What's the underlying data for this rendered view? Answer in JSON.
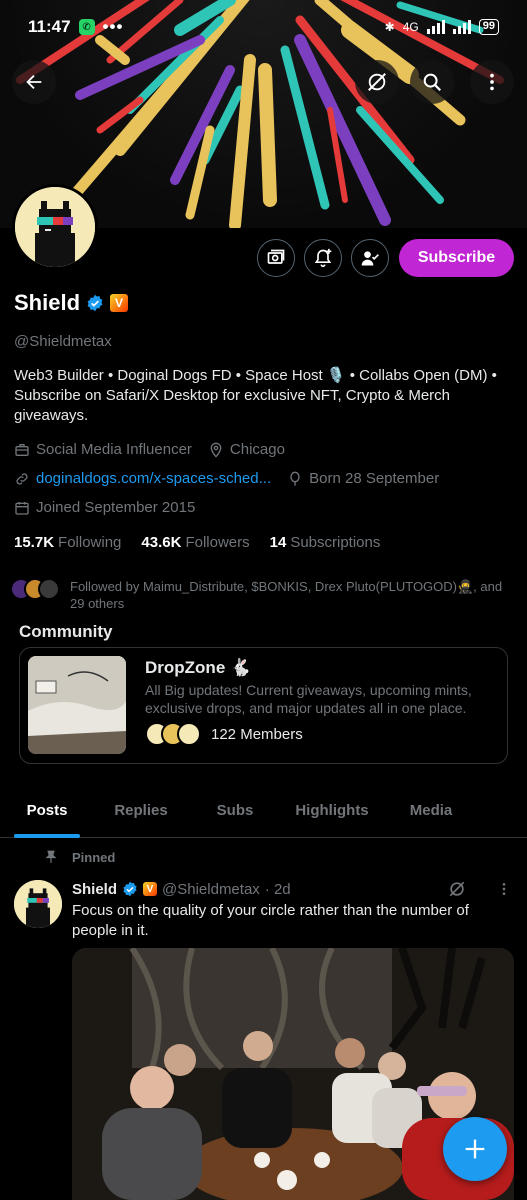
{
  "status_bar": {
    "time": "11:47",
    "dots": "•••",
    "network": "4G",
    "battery": "99"
  },
  "header": {
    "back_icon": "arrow-left-icon",
    "grok_icon": "grok-icon",
    "search_icon": "search-icon",
    "more_icon": "more-vertical-icon"
  },
  "profile": {
    "name": "Shield",
    "handle": "@Shieldmetax",
    "bio": "Web3 Builder • Doginal Dogs FD • Space Host 🎙️ • Collabs Open (DM) • Subscribe on Safari/X Desktop for exclusive NFT, Crypto & Merch giveaways.",
    "category": "Social Media Influencer",
    "location": "Chicago",
    "website": "doginaldogs.com/x-spaces-sched...",
    "born": "Born 28 September",
    "joined": "Joined September 2015",
    "subscribe_label": "Subscribe",
    "verified_badge": "V"
  },
  "stats": {
    "following_count": "15.7K",
    "following_label": "Following",
    "followers_count": "43.6K",
    "followers_label": "Followers",
    "subscriptions_count": "14",
    "subscriptions_label": "Subscriptions"
  },
  "followed_by": "Followed by Maimu_Distribute, $BONKIS, Drex Pluto(PLUTOGOD)🥷, and 29 others",
  "community": {
    "section_title": "Community",
    "name": "DropZone 🐇",
    "description": "All Big updates! Current giveaways, upcoming mints, exclusive drops, and major updates all in one place.",
    "members": "122 Members"
  },
  "tabs": [
    "Posts",
    "Replies",
    "Subs",
    "Highlights",
    "Media"
  ],
  "post": {
    "pinned_label": "Pinned",
    "name": "Shield",
    "handle": "@Shieldmetax",
    "time": "· 2d",
    "text": "Focus on the quality of your circle rather than the number of people in it."
  },
  "colors": {
    "accent": "#1d9bf0",
    "subscribe": "#c026d3",
    "muted": "#71767b"
  }
}
